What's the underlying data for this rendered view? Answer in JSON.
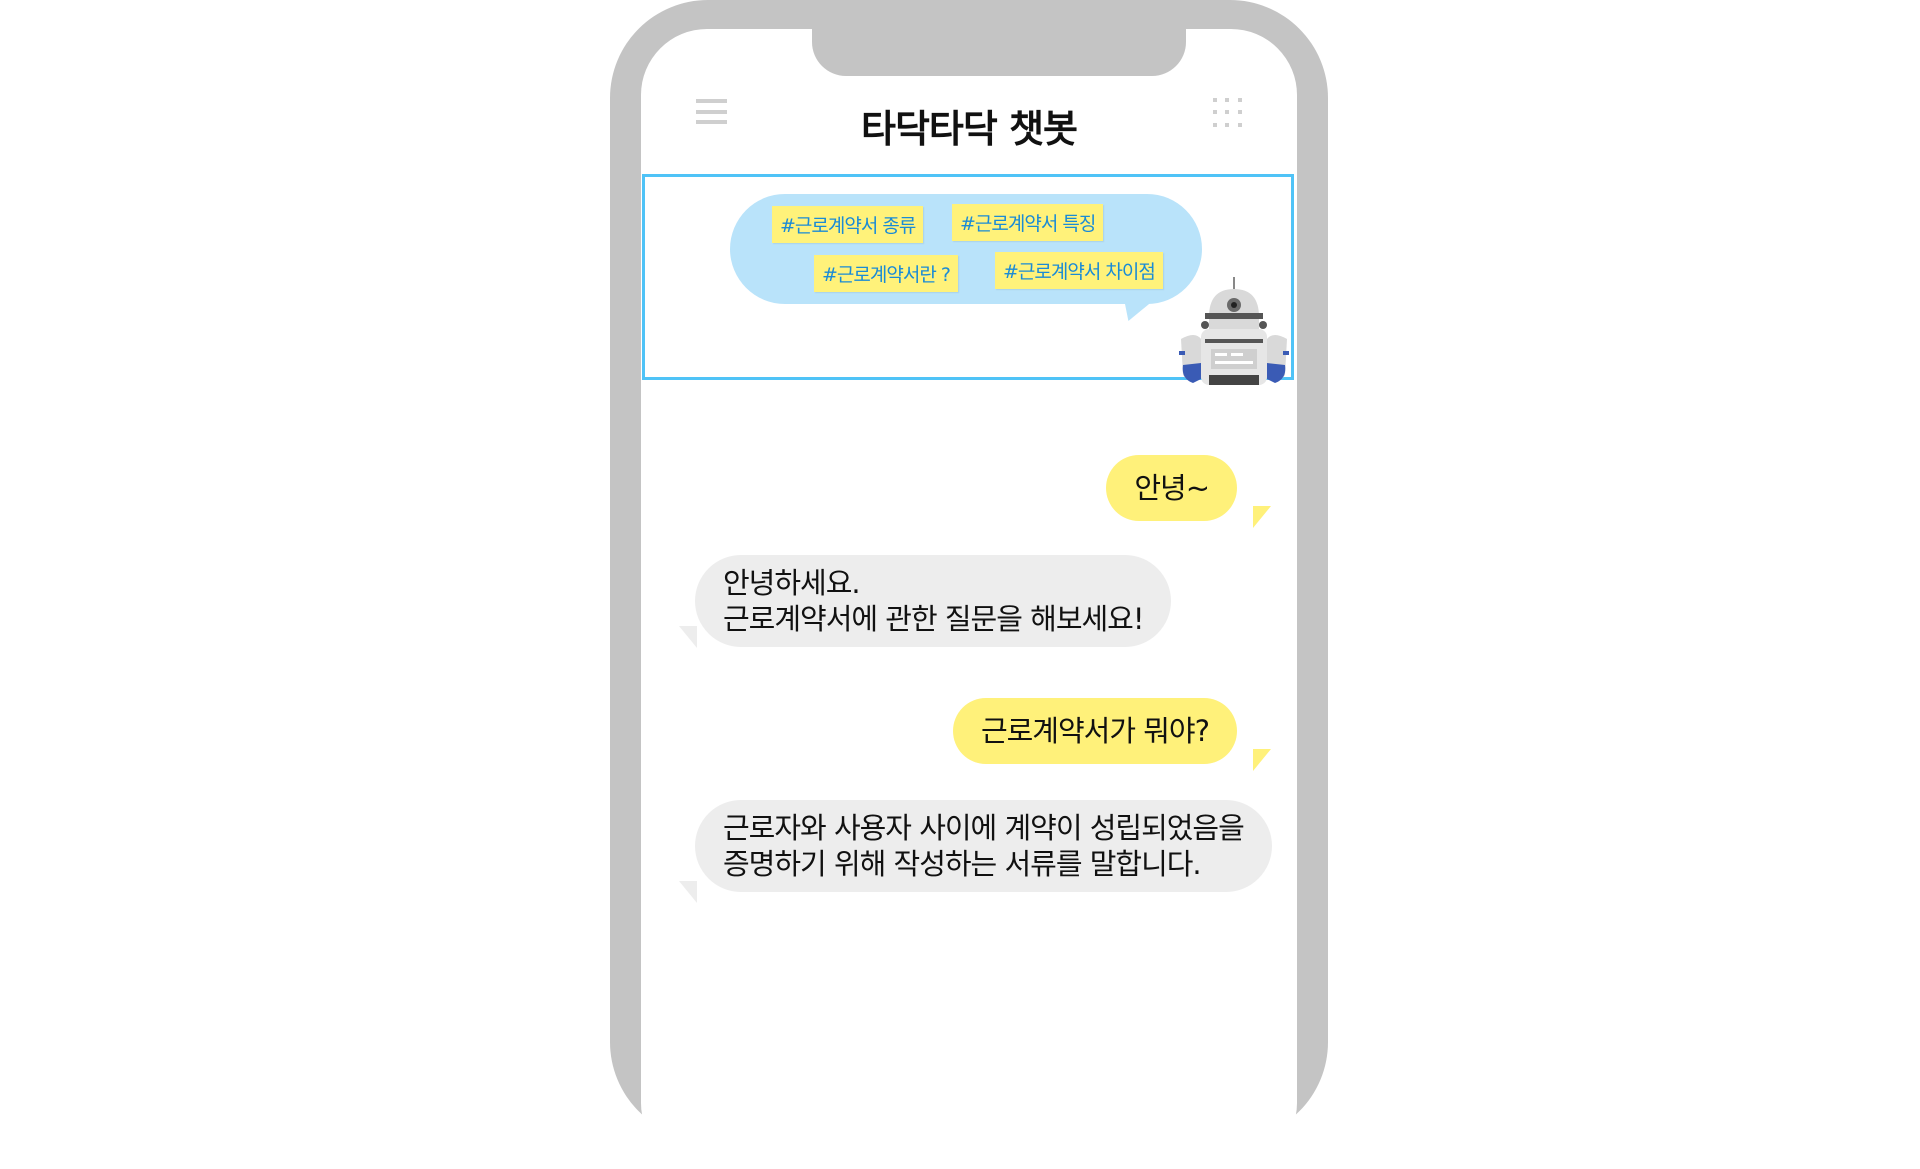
{
  "header": {
    "title": "타닥타닥 챗봇",
    "menu_icon": "hamburger-menu-icon",
    "apps_icon": "grid-apps-icon"
  },
  "faq": {
    "tags": [
      "#근로계약서 종류",
      "#근로계약서 특징",
      "#근로계약서란 ?",
      "#근로계약서 차이점"
    ]
  },
  "messages": [
    {
      "from": "user",
      "text": "안녕~"
    },
    {
      "from": "bot",
      "lines": [
        "안녕하세요.",
        "근로계약서에 관한 질문을 해보세요!"
      ]
    },
    {
      "from": "user",
      "text": "근로계약서가 뭐야?"
    },
    {
      "from": "bot",
      "lines": [
        "근로자와 사용자 사이에 계약이 성립되었음을",
        "증명하기 위해 작성하는 서류를 말합니다."
      ]
    }
  ],
  "colors": {
    "frame": "#c4c4c4",
    "user_bubble": "#fff17a",
    "bot_bubble": "#ededed",
    "faq_bubble": "#b9e3fa",
    "tag_bg": "#fff27a",
    "tag_text": "#1a8bd6",
    "faq_border": "#4fc3f7"
  }
}
